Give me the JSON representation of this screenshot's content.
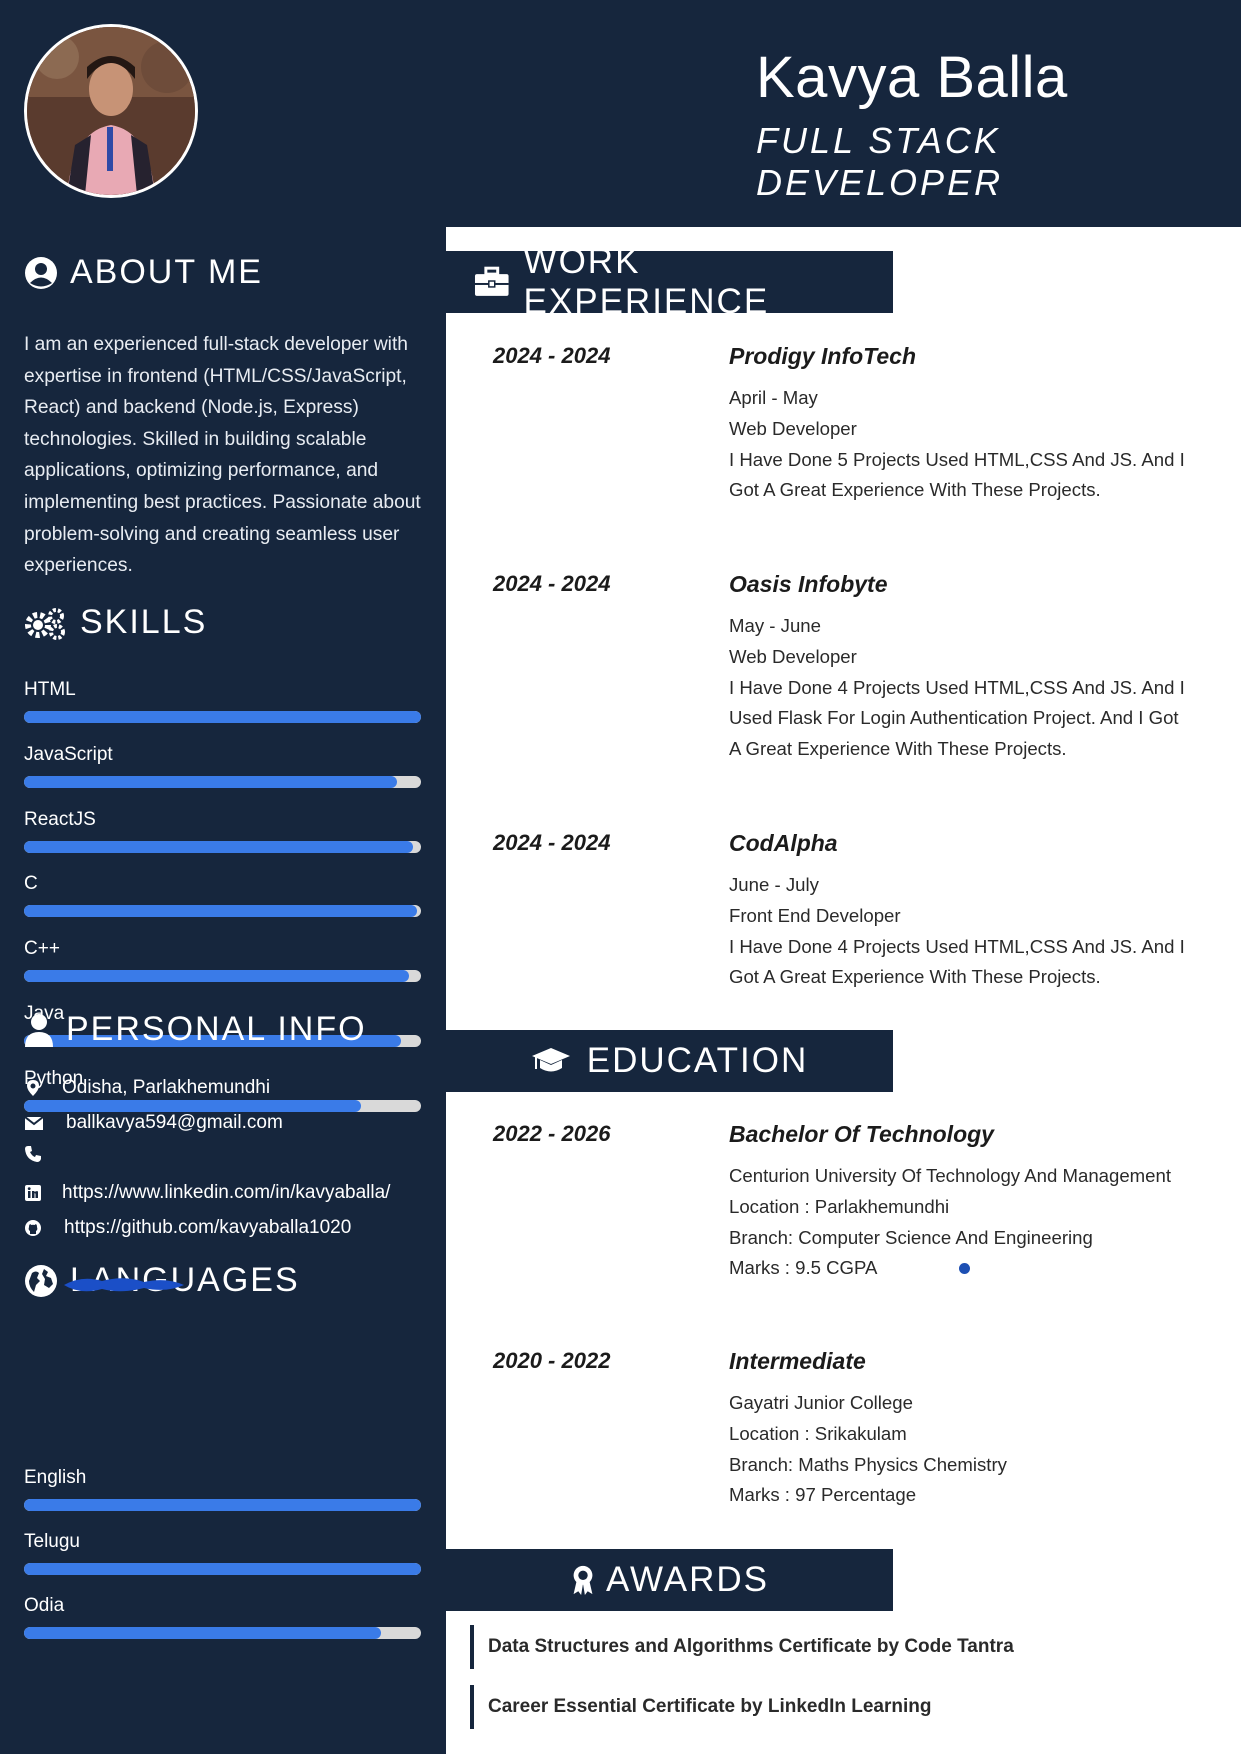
{
  "header": {
    "name": "Kavya Balla",
    "role": "FULL STACK DEVELOPER"
  },
  "about": {
    "heading": "ABOUT ME",
    "text": "I am an experienced full-stack developer with expertise in frontend (HTML/CSS/JavaScript, React) and backend (Node.js, Express) technologies. Skilled in building scalable applications, optimizing performance, and implementing best practices. Passionate about problem-solving and creating seamless user experiences."
  },
  "skills": {
    "heading": "SKILLS",
    "items": [
      {
        "label": "HTML",
        "level": 1.0
      },
      {
        "label": "JavaScript",
        "level": 0.94
      },
      {
        "label": "ReactJS",
        "level": 0.98
      },
      {
        "label": "C",
        "level": 0.99
      },
      {
        "label": "C++",
        "level": 0.97
      },
      {
        "label": "Java",
        "level": 0.95
      },
      {
        "label": "Python",
        "level": 0.85
      }
    ]
  },
  "personal_info": {
    "heading": "PERSONAL INFO",
    "location": "Odisha, Parlakhemundhi",
    "email": "ballkavya594@gmail.com",
    "linkedin": "https://www.linkedin.com/in/kavyaballa/",
    "github": "https://github.com/kavyaballa1020"
  },
  "languages": {
    "heading": "LANGUAGES",
    "items": [
      {
        "label": "English",
        "level": 1.0
      },
      {
        "label": "Telugu",
        "level": 1.0
      },
      {
        "label": "Odia",
        "level": 0.9
      }
    ]
  },
  "work": {
    "heading": "WORK EXPERIENCE",
    "entries": [
      {
        "years": "2024 - 2024",
        "company": "Prodigy InfoTech",
        "lines": [
          "April - May",
          "Web Developer",
          "I Have Done 5 Projects Used HTML,CSS And JS. And I",
          "Got A Great Experience With These Projects."
        ]
      },
      {
        "years": "2024 - 2024",
        "company": "Oasis Infobyte",
        "lines": [
          "May - June",
          "Web Developer",
          "I Have Done 4 Projects Used HTML,CSS And JS. And I",
          "Used Flask For Login Authentication Project. And I Got",
          "A Great Experience With These Projects."
        ]
      },
      {
        "years": "2024 - 2024",
        "company": "CodAlpha",
        "lines": [
          "June - July",
          "Front End Developer",
          "I Have Done 4 Projects Used HTML,CSS And JS. And I",
          "Got A Great Experience With These Projects."
        ]
      }
    ]
  },
  "education": {
    "heading": "EDUCATION",
    "entries": [
      {
        "years": "2022 - 2026",
        "degree": "Bachelor Of Technology",
        "lines": [
          "Centurion University Of Technology And Management",
          "Location : Parlakhemundhi",
          "Branch: Computer Science And Engineering",
          "Marks : 9.5 CGPA"
        ]
      },
      {
        "years": "2020 - 2022",
        "degree": "Intermediate",
        "lines": [
          "Gayatri Junior College",
          "Location : Srikakulam",
          "Branch: Maths Physics Chemistry",
          "Marks : 97 Percentage"
        ]
      }
    ]
  },
  "awards": {
    "heading": "AWARDS",
    "items": [
      "Data Structures and Algorithms Certificate by Code Tantra",
      "Career Essential Certificate by LinkedIn Learning"
    ]
  },
  "colors": {
    "navy": "#16263d",
    "bar_fill": "#3a7be8",
    "bar_track": "#d9d9d9"
  }
}
